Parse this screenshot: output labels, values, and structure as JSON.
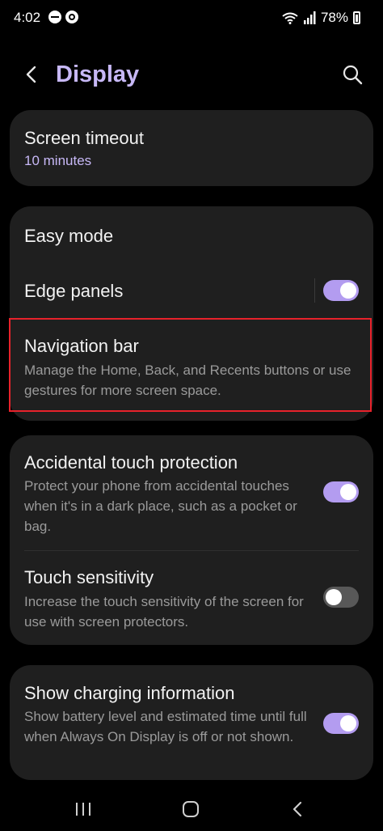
{
  "status_bar": {
    "time": "4:02",
    "icons": [
      "dnd-icon",
      "sync-icon",
      "wifi-icon",
      "signal-icon"
    ],
    "battery_label": "78%",
    "battery_level": 0.78
  },
  "header": {
    "title": "Display",
    "back_icon": "back-chevron-icon",
    "search_icon": "search-icon",
    "title_color": "#c7b8f6"
  },
  "screen_timeout": {
    "title": "Screen timeout",
    "value": "10 minutes"
  },
  "group1": {
    "easy_mode": {
      "title": "Easy mode"
    },
    "edge_panels": {
      "title": "Edge panels",
      "enabled": true
    },
    "navigation_bar": {
      "title": "Navigation bar",
      "description": "Manage the Home, Back, and Recents buttons or use gestures for more screen space.",
      "highlighted": true
    }
  },
  "group2": {
    "accidental_touch": {
      "title": "Accidental touch protection",
      "description": "Protect your phone from accidental touches when it's in a dark place, such as a pocket or bag.",
      "enabled": true
    },
    "touch_sensitivity": {
      "title": "Touch sensitivity",
      "description": "Increase the touch sensitivity of the screen for use with screen protectors.",
      "enabled": false
    }
  },
  "group3": {
    "charging_info": {
      "title": "Show charging information",
      "description": "Show battery level and estimated time until full when Always On Display is off or not shown.",
      "enabled": true
    }
  },
  "nav": {
    "buttons": [
      "recents-icon",
      "home-icon",
      "back-icon"
    ]
  },
  "colors": {
    "accent": "#c7b8f6",
    "toggle_on": "#b39cf0",
    "highlight_box": "#e8222b",
    "card_bg": "#1f1f1f"
  }
}
